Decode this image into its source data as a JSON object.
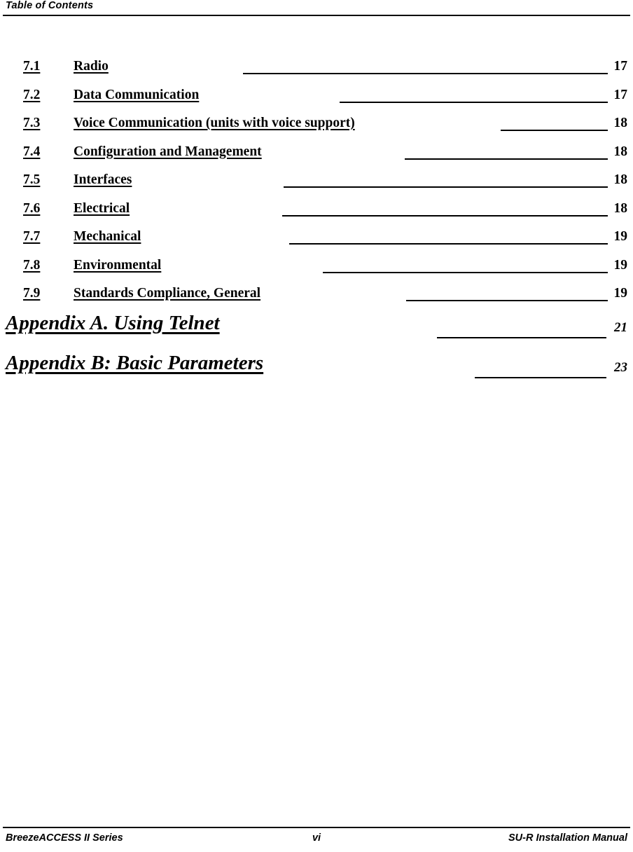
{
  "header": {
    "title": "Table of Contents"
  },
  "toc": {
    "sections": [
      {
        "number": "7.1",
        "title": "Radio",
        "trailing_space": false,
        "page": "17",
        "leader_width": 521
      },
      {
        "number": "7.2",
        "title": "Data Communication",
        "trailing_space": false,
        "page": "17",
        "leader_width": 383
      },
      {
        "number": "7.3",
        "title": "Voice Communication (units with voice support)",
        "trailing_space": false,
        "page": "18",
        "leader_width": 153
      },
      {
        "number": "7.4",
        "title": "Configuration and Management",
        "trailing_space": true,
        "page": "18",
        "leader_width": 290
      },
      {
        "number": "7.5",
        "title": "Interfaces",
        "trailing_space": true,
        "page": "18",
        "leader_width": 463
      },
      {
        "number": "7.6",
        "title": "Electrical",
        "trailing_space": true,
        "page": "18",
        "leader_width": 465
      },
      {
        "number": "7.7",
        "title": "Mechanical",
        "trailing_space": false,
        "page": "19",
        "leader_width": 455
      },
      {
        "number": "7.8",
        "title": "Environmental",
        "trailing_space": true,
        "page": "19",
        "leader_width": 407
      },
      {
        "number": "7.9",
        "title": "Standards Compliance, General",
        "trailing_space": true,
        "page": "19",
        "leader_width": 288
      }
    ],
    "appendices": [
      {
        "title": "Appendix A. Using Telnet",
        "trailing_space": false,
        "page": "21",
        "leader_width": 242
      },
      {
        "title": "Appendix B: Basic Parameters",
        "trailing_space": false,
        "page": "23",
        "leader_width": 188
      }
    ]
  },
  "footer": {
    "left": "BreezeACCESS II Series",
    "center": "vi",
    "right": "SU-R Installation Manual"
  }
}
